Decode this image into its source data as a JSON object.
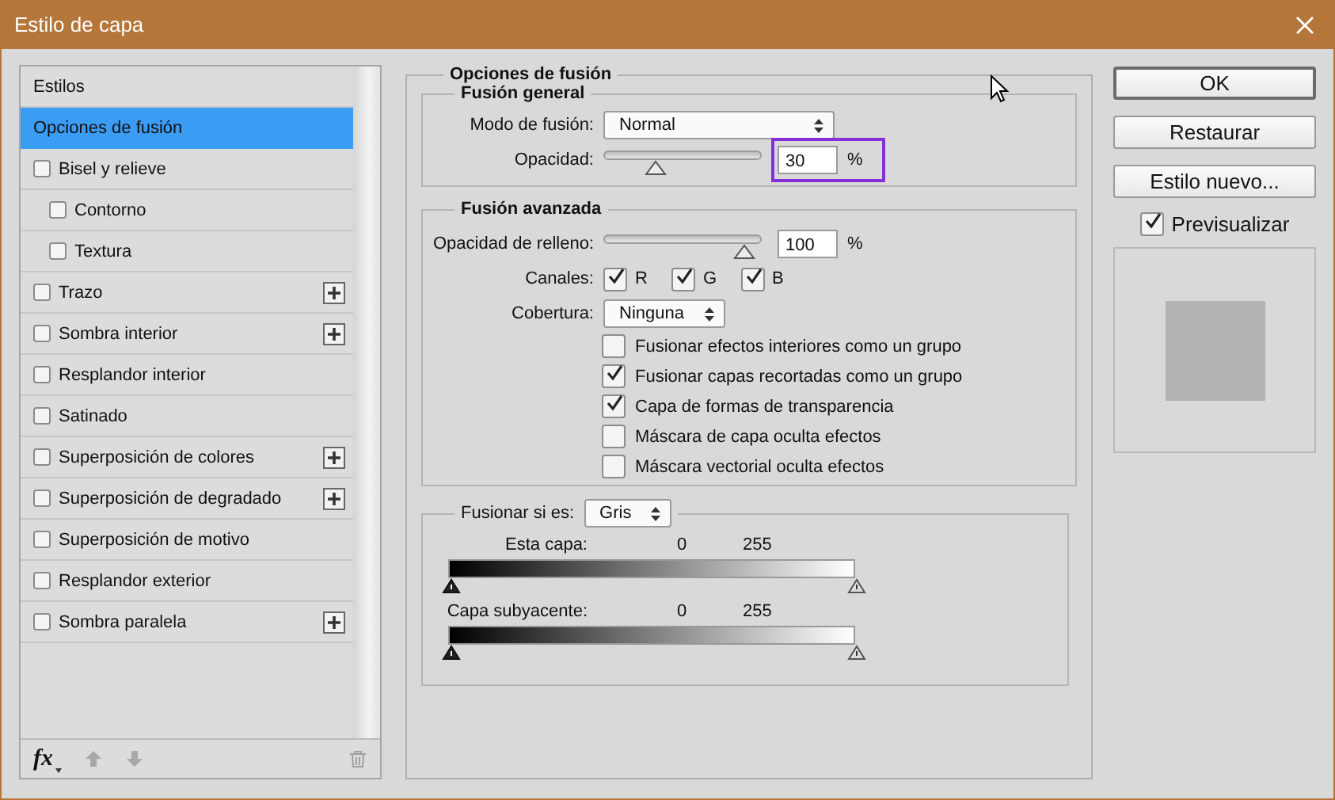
{
  "window": {
    "title": "Estilo de capa"
  },
  "styles_list": {
    "header": "Estilos",
    "items": [
      {
        "kind": "plain",
        "label": "Opciones de fusión",
        "selected": true
      },
      {
        "kind": "check",
        "label": "Bisel y relieve",
        "selected": false,
        "checked": false,
        "plus": false,
        "children": [
          {
            "kind": "check",
            "label": "Contorno",
            "selected": false,
            "checked": false,
            "plus": false
          },
          {
            "kind": "check",
            "label": "Textura",
            "selected": false,
            "checked": false,
            "plus": false
          }
        ]
      },
      {
        "kind": "check",
        "label": "Trazo",
        "selected": false,
        "checked": false,
        "plus": true
      },
      {
        "kind": "check",
        "label": "Sombra interior",
        "selected": false,
        "checked": false,
        "plus": true
      },
      {
        "kind": "check",
        "label": "Resplandor interior",
        "selected": false,
        "checked": false,
        "plus": false
      },
      {
        "kind": "check",
        "label": "Satinado",
        "selected": false,
        "checked": false,
        "plus": false
      },
      {
        "kind": "check",
        "label": "Superposición de colores",
        "selected": false,
        "checked": false,
        "plus": true
      },
      {
        "kind": "check",
        "label": "Superposición de degradado",
        "selected": false,
        "checked": false,
        "plus": true
      },
      {
        "kind": "check",
        "label": "Superposición de motivo",
        "selected": false,
        "checked": false,
        "plus": false
      },
      {
        "kind": "check",
        "label": "Resplandor exterior",
        "selected": false,
        "checked": false,
        "plus": false
      },
      {
        "kind": "check",
        "label": "Sombra paralela",
        "selected": false,
        "checked": false,
        "plus": true
      }
    ]
  },
  "blending_options": {
    "title": "Opciones de fusión",
    "general": {
      "title": "Fusión general",
      "mode_label": "Modo de fusión:",
      "mode_value": "Normal",
      "opacity_label": "Opacidad:",
      "opacity": {
        "level": 0.3,
        "value": "30",
        "unit": "%",
        "highlighted": true
      }
    },
    "advanced": {
      "title": "Fusión avanzada",
      "fill_label": "Opacidad de relleno:",
      "fill": {
        "level": 1,
        "value": "100",
        "unit": "%",
        "highlighted": false
      },
      "channels_label": "Canales:",
      "channels": [
        {
          "label": "R",
          "checked": true
        },
        {
          "label": "G",
          "checked": true
        },
        {
          "label": "B",
          "checked": true
        }
      ],
      "knockout_label": "Cobertura:",
      "knockout_value": "Ninguna",
      "options": [
        {
          "label": "Fusionar efectos interiores como un grupo",
          "checked": false
        },
        {
          "label": "Fusionar capas recortadas como un grupo",
          "checked": true
        },
        {
          "label": "Capa de formas de transparencia",
          "checked": true
        },
        {
          "label": "Máscara de capa oculta efectos",
          "checked": false
        },
        {
          "label": "Máscara vectorial oculta efectos",
          "checked": false
        }
      ]
    },
    "blend_if": {
      "label": "Fusionar si es:",
      "value": "Gris",
      "ranges": [
        {
          "label": "Esta capa:",
          "low": "0",
          "high": "255"
        },
        {
          "label": "Capa subyacente:",
          "low": "0",
          "high": "255"
        }
      ]
    }
  },
  "toolbar": {
    "fx": "fx"
  },
  "buttons": [
    {
      "label": "OK",
      "default": true
    },
    {
      "label": "Restaurar",
      "default": false
    },
    {
      "label": "Estilo nuevo...",
      "default": false
    }
  ],
  "preview": {
    "label": "Previsualizar",
    "checked": true
  }
}
